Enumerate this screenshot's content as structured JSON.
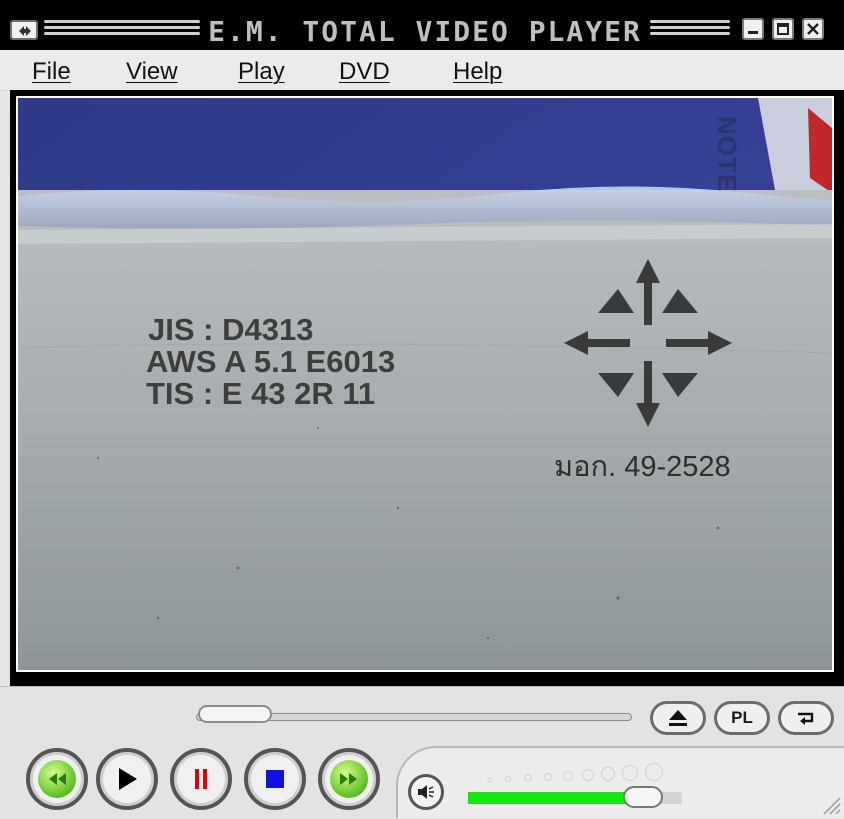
{
  "window": {
    "title": "E.M. TOTAL VIDEO PLAYER",
    "controls": [
      "minimize",
      "maximize",
      "close"
    ]
  },
  "menu": {
    "items": [
      {
        "label": "File"
      },
      {
        "label": "View"
      },
      {
        "label": "Play"
      },
      {
        "label": "DVD"
      },
      {
        "label": "Help"
      }
    ]
  },
  "video": {
    "frame_text": {
      "line1": "JIS : D4313",
      "line2": "AWS A 5.1 E6013",
      "line3": "TIS : E 43 2R 11",
      "standard_mark": "มอก. 49-2528",
      "box_edge_text": "NOTE"
    }
  },
  "controls": {
    "seek_position": 0.0,
    "buttons": {
      "eject": "eject-icon",
      "playlist_label": "PL",
      "repeat": "repeat-icon",
      "rewind": "rewind-icon",
      "play": "play-icon",
      "pause": "pause-icon",
      "stop": "stop-icon",
      "fast_forward": "fast-forward-icon",
      "mute": "speaker-icon"
    },
    "volume_level": 0.82,
    "colors": {
      "volume_fill": "#16e616",
      "pause_icon": "#e00000",
      "stop_icon": "#1010e0",
      "transport_green": "#63c42c"
    }
  }
}
